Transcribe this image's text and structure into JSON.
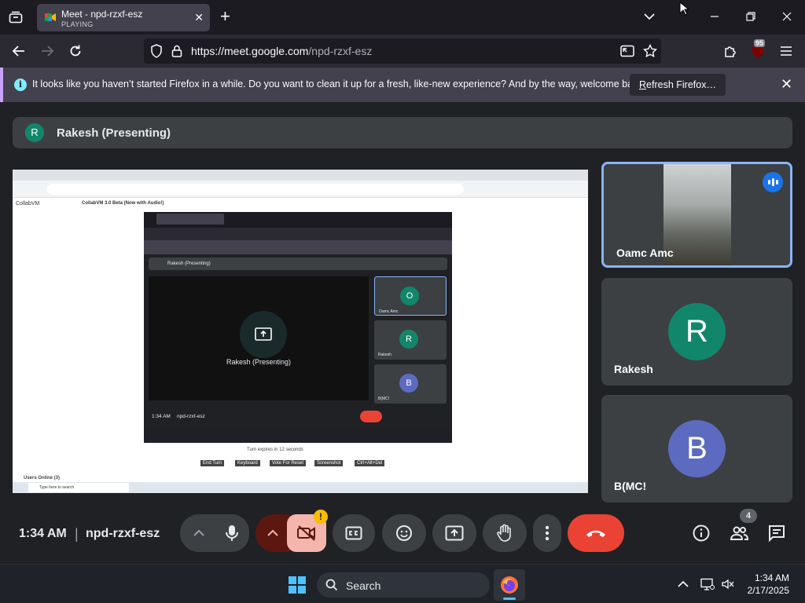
{
  "browser": {
    "tab": {
      "title": "Meet - npd-rzxf-esz",
      "status": "PLAYING"
    },
    "url": {
      "host": "https://meet.google.com",
      "path": "/npd-rzxf-esz"
    },
    "extension_badge": "95"
  },
  "notification": {
    "message": "It looks like you haven’t started Firefox in a while. Do you want to clean it up for a fresh, like-new experience? And by the way, welcome back!",
    "button_label": "Refresh Firefox…",
    "button_accesskey_char": "R",
    "button_rest": "efresh Firefox…"
  },
  "meet": {
    "presenter_banner": {
      "initial": "R",
      "label": "Rakesh (Presenting)"
    },
    "shared_screen": {
      "app_name": "CollabVM",
      "app_title": "CollabVM 3.0 Beta (Now with Audio!)",
      "inner_presenting_label": "Rakesh (Presenting)",
      "inner_time": "1:34 AM",
      "inner_code": "npd-rzxf-esz",
      "inner_tiles": [
        {
          "initial": "O",
          "name": "Oamc Amc",
          "color": "#12866b"
        },
        {
          "initial": "R",
          "name": "Rakesh",
          "color": "#12866b"
        },
        {
          "initial": "B",
          "name": "B(MC!",
          "color": "#5c6bc0"
        }
      ],
      "turn_text": "Turn expires in 12 seconds",
      "vm_buttons": [
        "End Turn",
        "Keyboard",
        "Vote For Reset",
        "Screenshot",
        "Ctrl+Alt+Del"
      ],
      "users_online": "Users Online (3)",
      "taskbar_search": "Type here to search"
    },
    "participants": [
      {
        "name": "Oamc Amc",
        "initial": "O",
        "has_video": true,
        "speaking": true
      },
      {
        "name": "Rakesh",
        "initial": "R",
        "color": "#12866b"
      },
      {
        "name": "B(MC!",
        "initial": "B",
        "color": "#5c6bc0"
      }
    ],
    "controls": {
      "time": "1:34 AM",
      "separator": "|",
      "meeting_code": "npd-rzxf-esz",
      "warning_badge": "!",
      "people_count": "4"
    }
  },
  "taskbar": {
    "search_label": "Search",
    "time": "1:34 AM",
    "date": "2/17/2025"
  }
}
